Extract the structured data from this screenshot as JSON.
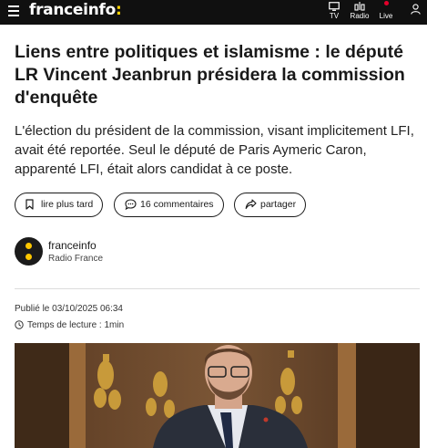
{
  "header": {
    "logo_text": "franceinfo",
    "logo_suffix": ":",
    "nav": [
      {
        "label": "TV",
        "icon": "tv-icon"
      },
      {
        "label": "Radio",
        "icon": "radio-icon"
      },
      {
        "label": "Live",
        "icon": "live-icon"
      }
    ],
    "account_icon": "user-icon"
  },
  "article": {
    "title": "Liens entre politiques et islamisme : le député LR Vincent Jeanbrun présidera la commission d'enquête",
    "chapo": "L'élection du président de la commission, visant implicitement LFI, avait été reportée. Seul le député de Paris Aymeric Caron, apparenté LFI, était alors candidat à ce poste.",
    "actions": {
      "read_later": "lire plus tard",
      "comments": "16 commentaires",
      "share": "partager"
    },
    "author": {
      "name": "franceinfo",
      "organization": "Radio France"
    },
    "published": "Publié le 03/10/2025 06:34",
    "reading_time": "Temps de lecture : 1min"
  },
  "colors": {
    "header_bg": "#101010",
    "accent_yellow": "#ffd400",
    "live_red": "#e4002b"
  }
}
